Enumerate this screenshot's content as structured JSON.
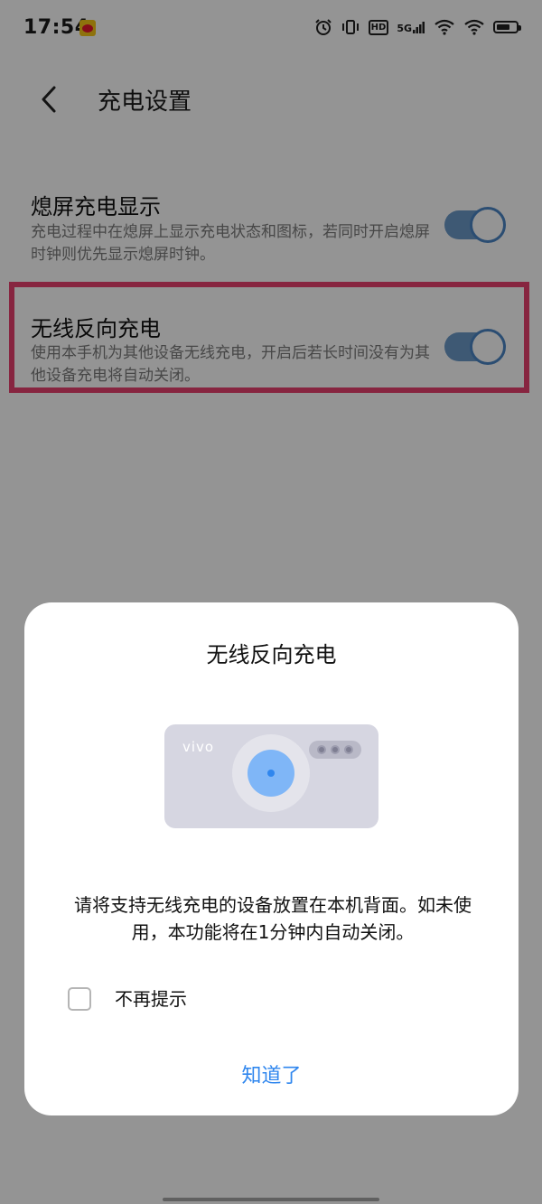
{
  "status_bar": {
    "time": "17:54",
    "app_icon": "weibo-icon",
    "icons": [
      "alarm-icon",
      "vibrate-icon",
      "hd-icon",
      "5g-signal-icon",
      "wifi-signal-icon",
      "wifi-icon",
      "battery-icon"
    ],
    "hd_label": "HD",
    "network_label": "5G"
  },
  "header": {
    "back_icon": "chevron-left-icon",
    "title": "充电设置"
  },
  "settings": [
    {
      "title": "熄屏充电显示",
      "description": "充电过程中在熄屏上显示充电状态和图标，若同时开启熄屏时钟则优先显示熄屏时钟。",
      "enabled": true
    },
    {
      "title": "无线反向充电",
      "description": "使用本手机为其他设备无线充电，开启后若长时间没有为其他设备充电将自动关闭。",
      "enabled": true,
      "highlighted": true
    }
  ],
  "dialog": {
    "title": "无线反向充电",
    "illustration_brand": "vivo",
    "message": "请将支持无线充电的设备放置在本机背面。如未使用，本功能将在1分钟内自动关闭。",
    "checkbox_label": "不再提示",
    "checkbox_checked": false,
    "confirm_label": "知道了"
  },
  "colors": {
    "accent": "#2f86ee",
    "highlight": "#e8416f",
    "toggle_track": "#6b9ac9"
  }
}
